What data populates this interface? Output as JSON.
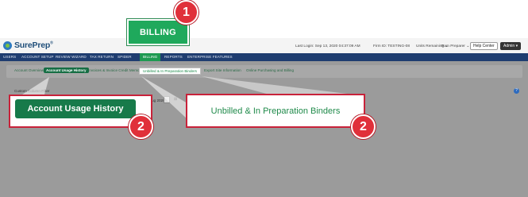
{
  "header": {
    "logo_text": "SurePrep",
    "last_login": "Last Login: Sep 13, 2020 04:37:09 AM",
    "firm_id": "Firm ID: TESTING-08",
    "units_remaining": "Units Remaining",
    "user": "Pam Preparer",
    "help_center": "Help Center",
    "admin": "Admin"
  },
  "nav": {
    "items": [
      "USERS",
      "ACCOUNT SETUP",
      "REVIEW WIZARD",
      "TAX RETURN",
      "SPIDER",
      "BILLING",
      "REPORTS",
      "ENTERPRISE FEATURES"
    ]
  },
  "subnav": {
    "items": [
      "Account Overview",
      "Account Usage History",
      "Invoices & Invoice Credit Memos",
      "Unbilled & In Preparation Binders",
      "Export Site Information",
      "Online Purchasing and Billing"
    ]
  },
  "content": {
    "filter_label": "Custom Column Filter",
    "date_fragment": "Aug 2020",
    "help_icon": "?"
  },
  "callouts": {
    "billing": "BILLING",
    "account_usage": "Account Usage History",
    "unbilled": "Unbilled & In Preparation Binders",
    "badge_1": "1",
    "badge_2": "2"
  },
  "icons": [
    "logo-mark-icon",
    "calendar-icon",
    "chevron-down-icon",
    "help-icon"
  ],
  "colors": {
    "nav_bg": "#1f3d70",
    "billing_green": "#1f9a52",
    "badge_red": "#e0303a",
    "content_gray": "#9b9b9b"
  }
}
